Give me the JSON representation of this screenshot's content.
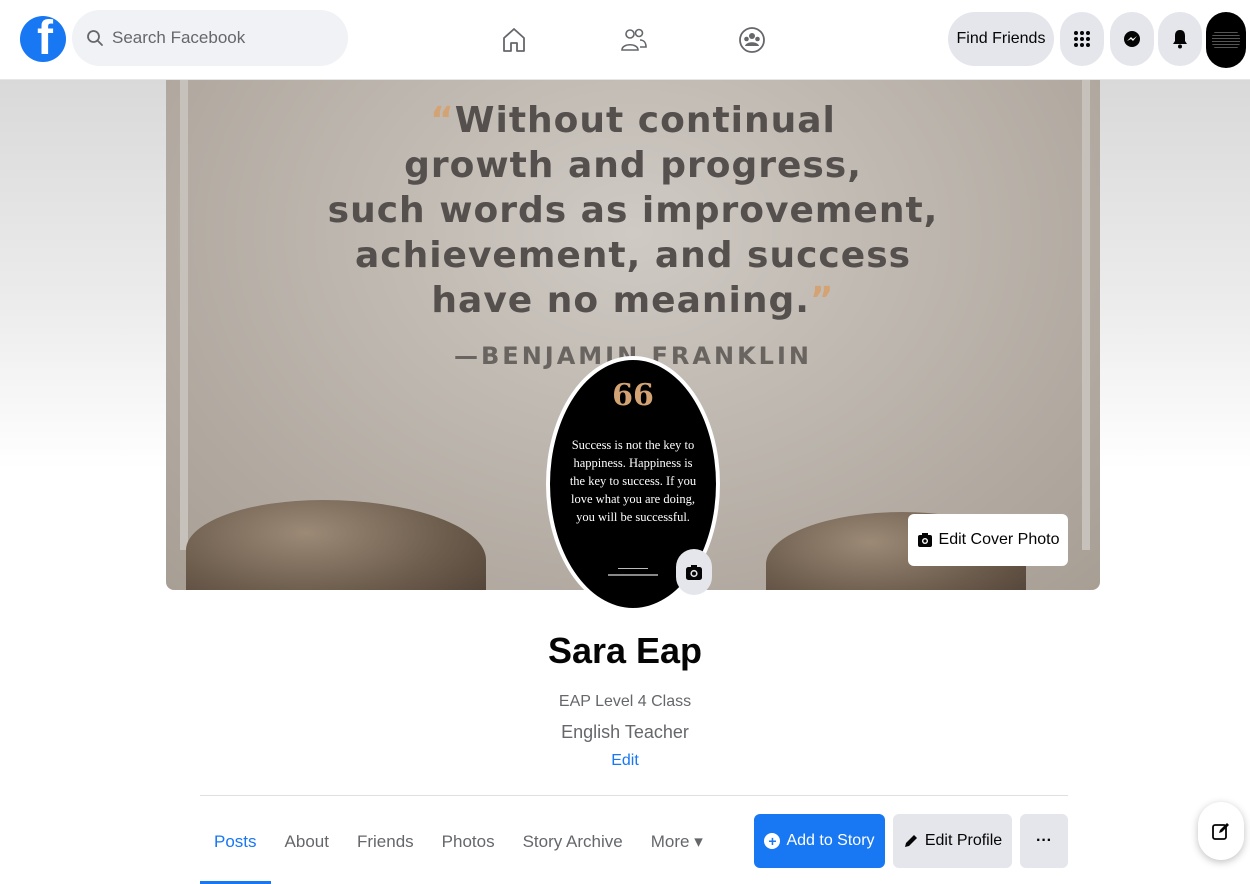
{
  "topbar": {
    "logo": "f",
    "search_placeholder": "Search Facebook",
    "nav_icons": [
      "home-icon",
      "friends-icon",
      "groups-icon"
    ],
    "find_friends_label": "Find Friends",
    "right_icons": [
      "menu-grid-icon",
      "messenger-icon",
      "notifications-icon"
    ]
  },
  "cover": {
    "quote_lines": [
      "Without continual",
      "growth and progress,",
      "such words as improvement,",
      "achievement, and success",
      "have no meaning."
    ],
    "author": "—BENJAMIN FRANKLIN",
    "edit_cover_label": "Edit Cover Photo"
  },
  "profile_picture": {
    "quote_mark": "66",
    "text": "Success is not the key to happiness. Happiness is the key to success. If you love what you are doing, you will be successful."
  },
  "profile": {
    "name": "Sara Eap",
    "intro_line1": "EAP Level 4 Class",
    "intro_line2": "English Teacher",
    "edit_label": "Edit"
  },
  "tabs": [
    {
      "label": "Posts",
      "active": true
    },
    {
      "label": "About",
      "active": false
    },
    {
      "label": "Friends",
      "active": false
    },
    {
      "label": "Photos",
      "active": false
    },
    {
      "label": "Story Archive",
      "active": false
    },
    {
      "label": "More ▾",
      "active": false
    }
  ],
  "actions": {
    "add_story_label": "Add to Story",
    "edit_profile_label": "Edit Profile",
    "more_label": "···"
  },
  "colors": {
    "brand": "#1877f2",
    "button_grey": "#e4e6eb",
    "text_secondary": "#65676b"
  }
}
